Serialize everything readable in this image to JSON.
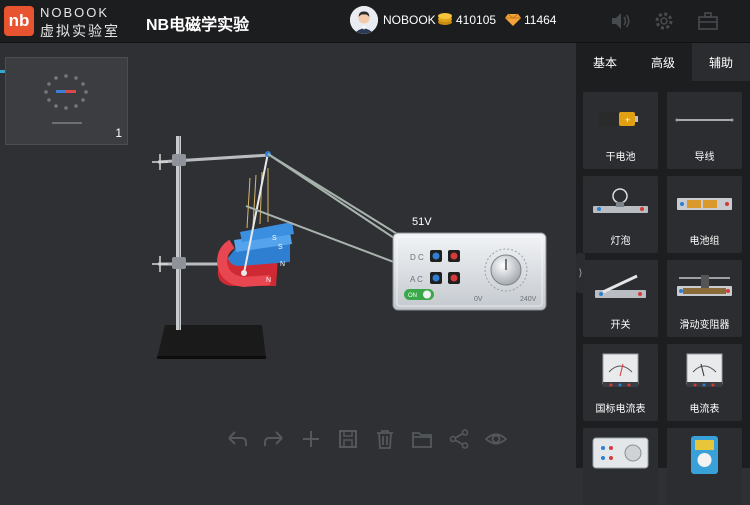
{
  "header": {
    "logo_mark": "nb",
    "logo_text": "NOBOOK",
    "logo_subtitle": "虚拟实验室",
    "app_title": "NB电磁学实验",
    "user_name": "NOBOOK",
    "coins": "410105",
    "gems": "11464",
    "icons": [
      "volume-icon",
      "settings-icon",
      "toolbox-icon"
    ]
  },
  "thumbnail": {
    "page_number": "1"
  },
  "experiment": {
    "voltage_reading": "51V"
  },
  "power_supply": {
    "dc_label": "D C",
    "ac_label": "A C",
    "min_label": "0V",
    "max_label": "240V",
    "switch_label": "ON"
  },
  "toolbar_icons": [
    "undo-icon",
    "redo-icon",
    "add-icon",
    "save-icon",
    "delete-icon",
    "folder-icon",
    "share-icon",
    "view-icon"
  ],
  "panel": {
    "tabs": [
      "基本",
      "高级",
      "辅助"
    ],
    "active_tab": "辅助",
    "items": [
      {
        "label": "干电池",
        "icon": "battery-icon"
      },
      {
        "label": "导线",
        "icon": "wire-icon"
      },
      {
        "label": "灯泡",
        "icon": "bulb-icon"
      },
      {
        "label": "电池组",
        "icon": "battery-pack-icon"
      },
      {
        "label": "开关",
        "icon": "switch-icon"
      },
      {
        "label": "滑动变阻器",
        "icon": "rheostat-icon"
      },
      {
        "label": "国标电流表",
        "icon": "ammeter-gb-icon"
      },
      {
        "label": "电流表",
        "icon": "ammeter-icon"
      },
      {
        "label": "",
        "icon": "power-supply-icon"
      },
      {
        "label": "",
        "icon": "meter-icon"
      }
    ]
  }
}
